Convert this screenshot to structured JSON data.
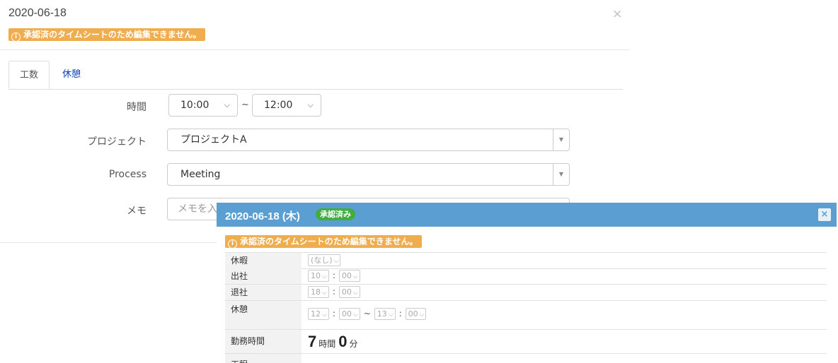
{
  "background_modal": {
    "date": "2020-06-18",
    "close_glyph": "×",
    "warning": "承認済のタイムシートのため編集できません。",
    "tabs": [
      "工数",
      "休憩"
    ],
    "time_label": "時間",
    "time_start": "10:00",
    "time_separator": "~",
    "time_end": "12:00",
    "project_label": "プロジェクト",
    "project_value": "プロジェクトA",
    "process_label": "Process",
    "process_value": "Meeting",
    "memo_label": "メモ",
    "memo_placeholder": "メモを入"
  },
  "dialog": {
    "title": "2020-06-18 (木)",
    "badge": "承認済み",
    "close_glyph": "×",
    "warning": "承認済のタイムシートのため編集できません。",
    "rows": {
      "leave": {
        "label": "休暇",
        "value": "(なし)"
      },
      "clock_in": {
        "label": "出社",
        "hour": "10",
        "minute": "00"
      },
      "clock_out": {
        "label": "退社",
        "hour": "18",
        "minute": "00"
      },
      "break": {
        "label": "休憩",
        "start_hour": "12",
        "start_minute": "00",
        "separator": "~",
        "end_hour": "13",
        "end_minute": "00"
      },
      "work_time": {
        "label": "勤務時間",
        "hours": "7",
        "hours_unit": "時間",
        "minutes": "0",
        "minutes_unit": "分"
      }
    },
    "partial_row_label": "工程"
  },
  "colors": {
    "warning": "#f0ad4e",
    "dialog_header": "#5b9fd2",
    "badge": "#3fae3f",
    "link": "#0645ad"
  },
  "icons": [
    "info-icon",
    "close-icon",
    "chevron-down-icon"
  ]
}
